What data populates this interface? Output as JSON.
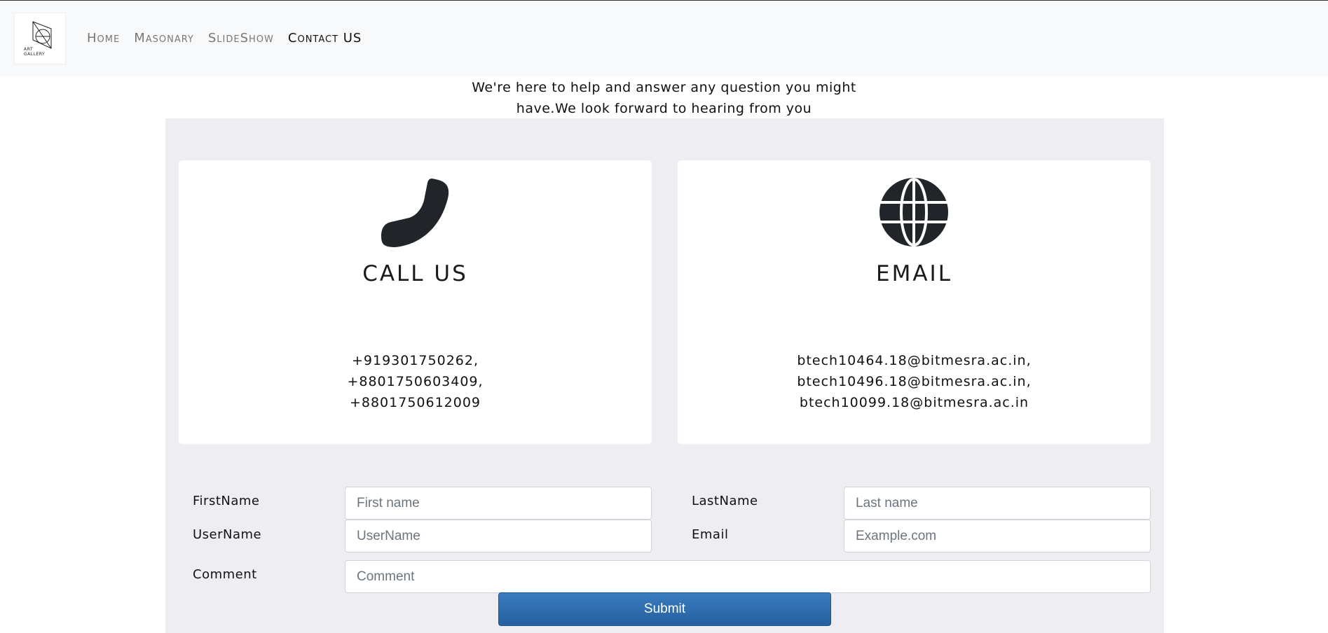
{
  "navbar": {
    "logo_text_line1": "ART",
    "logo_text_line2": "GALLERY",
    "links": [
      {
        "label": "Home"
      },
      {
        "label": "Masonary"
      },
      {
        "label": "SlideShow"
      },
      {
        "label": "Contact US"
      }
    ]
  },
  "intro": {
    "line1": "We're here to help and answer any question you might",
    "line2": "have.We look forward to hearing from you"
  },
  "cards": {
    "call": {
      "icon": "phone-icon",
      "title": "CALL US",
      "lines": [
        "+919301750262,",
        "+8801750603409,",
        "+8801750612009"
      ]
    },
    "email": {
      "icon": "globe-icon",
      "title": "EMAIL",
      "lines": [
        "btech10464.18@bitmesra.ac.in,",
        "btech10496.18@bitmesra.ac.in,",
        "btech10099.18@bitmesra.ac.in"
      ]
    }
  },
  "form": {
    "firstname_label": "FirstName",
    "firstname_placeholder": "First name",
    "lastname_label": "LastName",
    "lastname_placeholder": "Last name",
    "username_label": "UserName",
    "username_placeholder": "UserName",
    "email_label": "Email",
    "email_placeholder": "Example.com",
    "comment_label": "Comment",
    "comment_placeholder": "Comment",
    "submit_label": "Submit"
  },
  "colors": {
    "navbar_bg": "#f8f9fa",
    "panel_bg": "#eeeef2",
    "submit_bg": "#2e6fb0"
  }
}
